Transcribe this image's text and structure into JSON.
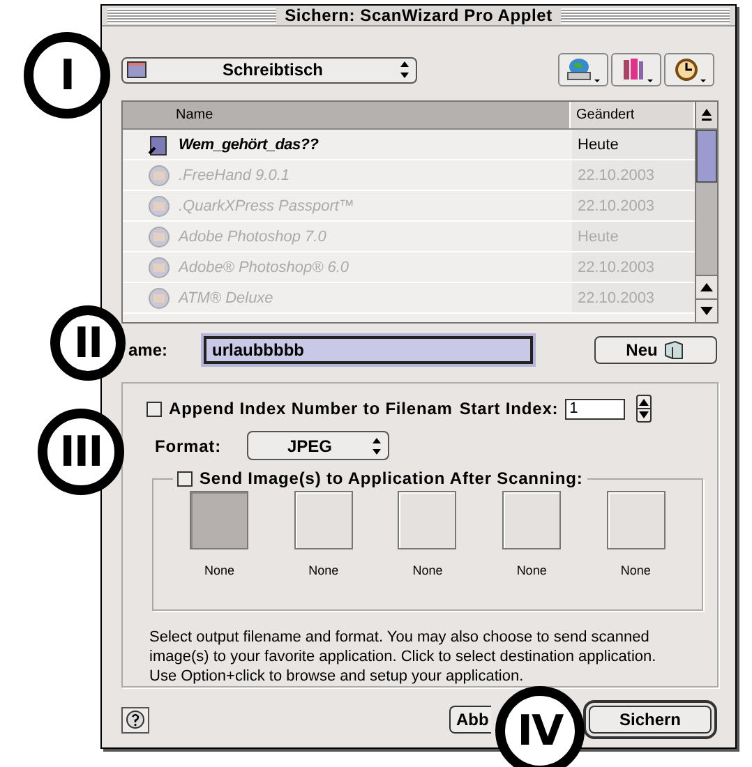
{
  "window": {
    "title": "Sichern: ScanWizard Pro Applet"
  },
  "location_popup": {
    "label": "Schreibtisch"
  },
  "toolbar_buttons": [
    {
      "kind": "volume"
    },
    {
      "kind": "favorites"
    },
    {
      "kind": "recent"
    }
  ],
  "file_list": {
    "columns": [
      {
        "label": "Name",
        "sorted": true
      },
      {
        "label": "Geändert",
        "sorted": false
      }
    ],
    "rows": [
      {
        "name": "Wem_gehört_das??",
        "date": "Heute",
        "dimmed": false
      },
      {
        "name": ".FreeHand 9.0.1",
        "date": "22.10.2003",
        "dimmed": true
      },
      {
        "name": ".QuarkXPress Passport™",
        "date": "22.10.2003",
        "dimmed": true
      },
      {
        "name": "Adobe Photoshop 7.0",
        "date": "Heute",
        "dimmed": true
      },
      {
        "name": "Adobe® Photoshop® 6.0",
        "date": "22.10.2003",
        "dimmed": true
      },
      {
        "name": "ATM® Deluxe",
        "date": "22.10.2003",
        "dimmed": true
      }
    ]
  },
  "name_field": {
    "label": "ame:",
    "value": "urlaubbbbb"
  },
  "new_folder_button": {
    "label": "Neu"
  },
  "append_index": {
    "label": "Append Index Number to Filenam",
    "checked": false
  },
  "start_index": {
    "label": "Start Index:",
    "value": "1"
  },
  "format": {
    "label": "Format:",
    "value": "JPEG"
  },
  "send_to_app": {
    "label": "Send Image(s) to Application After Scanning:",
    "checked": false,
    "apps": [
      {
        "label": "None",
        "selected": true
      },
      {
        "label": "None",
        "selected": false
      },
      {
        "label": "None",
        "selected": false
      },
      {
        "label": "None",
        "selected": false
      },
      {
        "label": "None",
        "selected": false
      }
    ]
  },
  "description": "Select output filename and format. You may also choose to send scanned image(s) to your favorite application. Click to select destination application. Use Option+click to browse and setup your application.",
  "buttons": [
    {
      "label": "Abb",
      "kind": "cancel"
    },
    {
      "label": "Sichern",
      "kind": "default"
    }
  ],
  "annotations": [
    {
      "label": "I"
    },
    {
      "label": "II"
    },
    {
      "label": "III"
    },
    {
      "label": "IV"
    }
  ]
}
